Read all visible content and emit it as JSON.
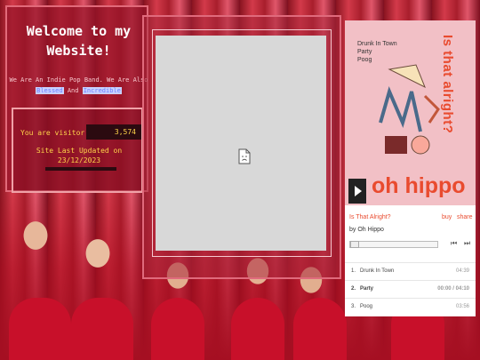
{
  "site": {
    "title": "Welcome to my Website!",
    "tagline_prefix": "We Are An Indie Pop Band. We Are Also",
    "tagline_link_1": "Blessed",
    "tagline_and": "And",
    "tagline_link_2": "Incredible",
    "visitor_label": "You are visitor",
    "visitor_count": "3,574",
    "updated_label": "Site Last Updated on",
    "updated_date": "23/12/2023"
  },
  "embed": {
    "icon": "broken-image-icon"
  },
  "player": {
    "album_credits": [
      "Drunk In Town",
      "Party",
      "Poog"
    ],
    "album_vertical_title": "Is that alright?",
    "album_band": "oh hippo",
    "track_title": "Is That Alright?",
    "buy_label": "buy",
    "share_label": "share",
    "artist_line": "by Oh Hippo",
    "tracks": [
      {
        "num": "1.",
        "name": "Drunk In Town",
        "time": "04:39"
      },
      {
        "num": "2.",
        "name": "Party",
        "time": "00:00 / 04:10"
      },
      {
        "num": "3.",
        "name": "Poog",
        "time": "03:56"
      }
    ],
    "prev_icon": "prev-track-icon",
    "next_icon": "next-track-icon"
  },
  "colors": {
    "accent": "#e94b2f",
    "counter_text": "#ffd54a",
    "link": "#6b7dff"
  }
}
